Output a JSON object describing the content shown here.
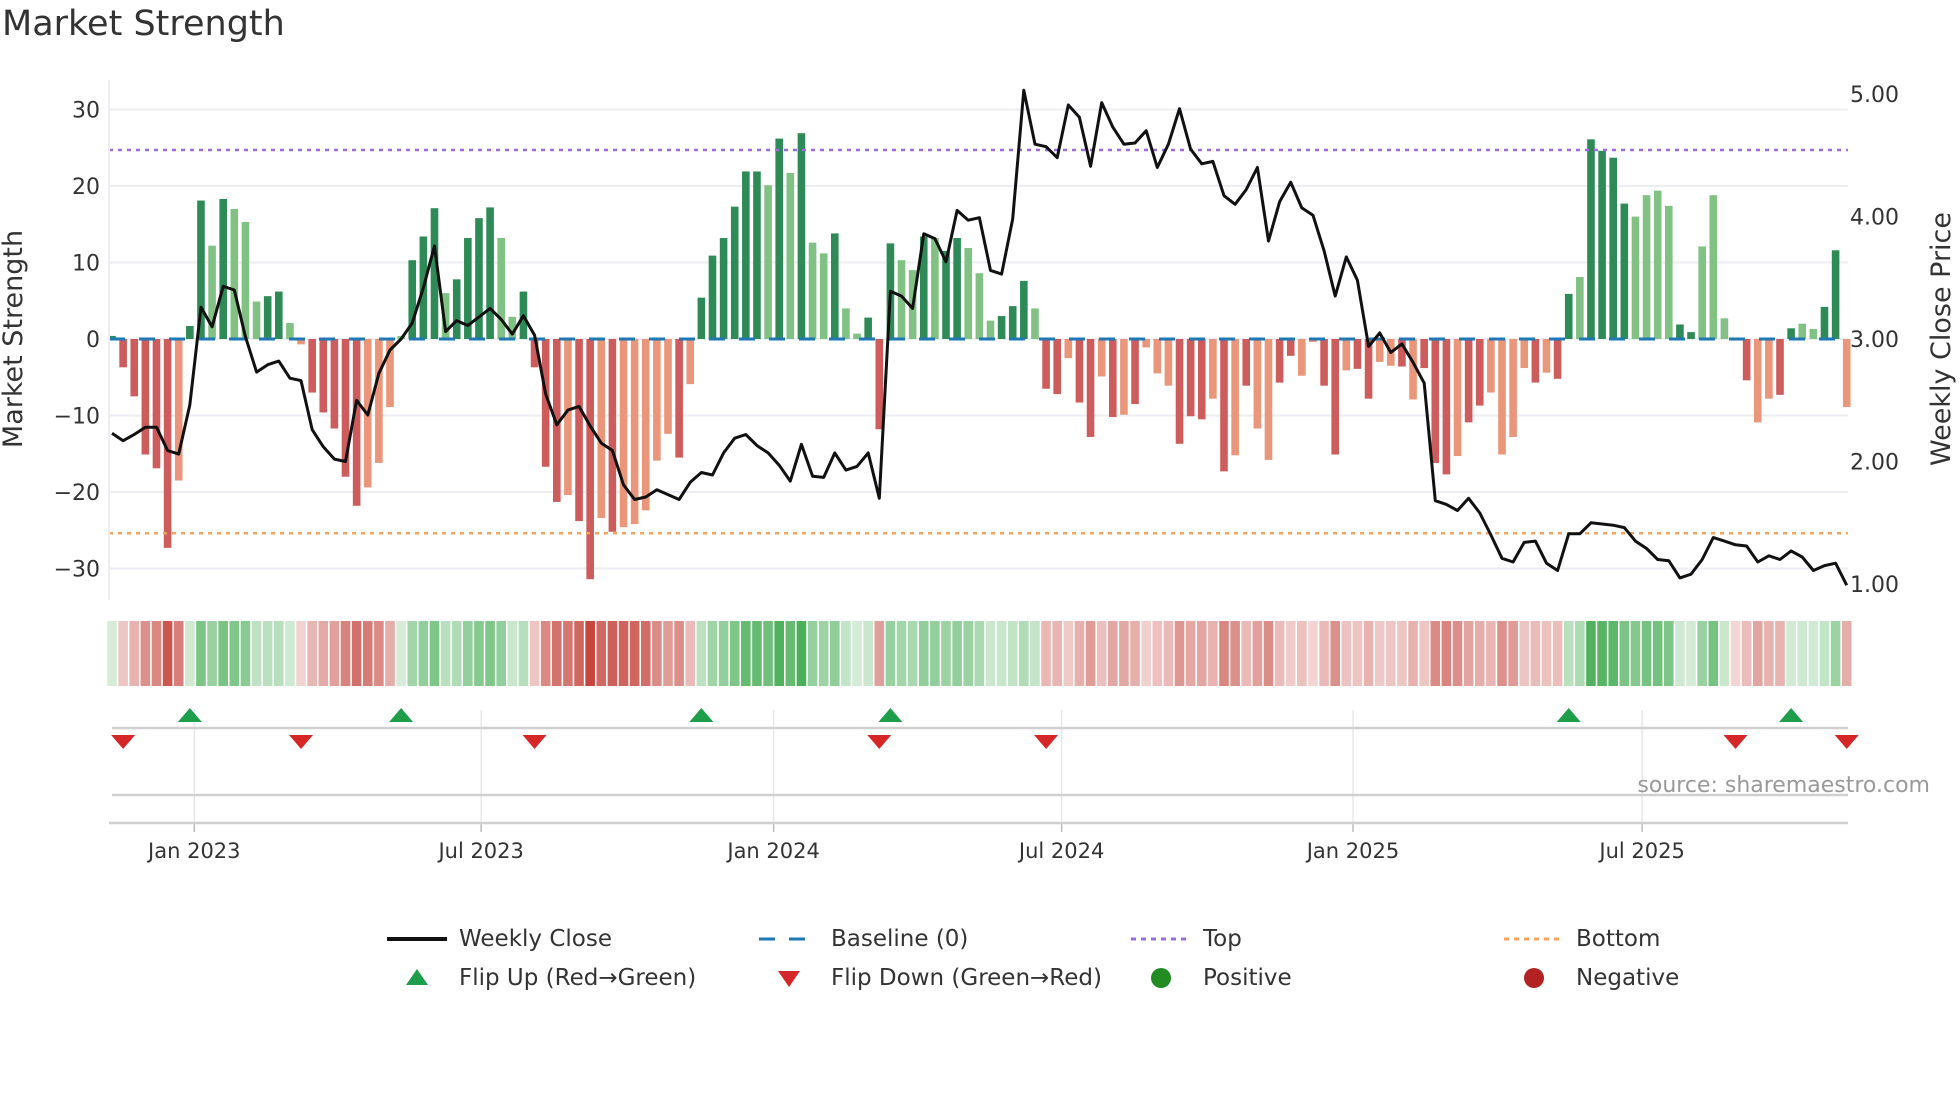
{
  "title": "Market Strength",
  "source": "source: sharemaestro.com",
  "legend": {
    "weekly_close": "Weekly Close",
    "baseline": "Baseline (0)",
    "top": "Top",
    "bottom": "Bottom",
    "flip_up": "Flip Up (Red→Green)",
    "flip_down": "Flip Down (Green→Red)",
    "positive": "Positive",
    "negative": "Negative"
  },
  "colors": {
    "strong_green": "#2e8b57",
    "light_green": "#82c184",
    "strong_red": "#cd5c5c",
    "light_red": "#e9967a",
    "close": "#111111",
    "baseline": "#1f77b4",
    "top": "#9b6ddb",
    "bottom": "#f4a460",
    "flip_up": "#1e9e4a",
    "flip_down": "#d62728",
    "positive": "#228b22",
    "negative": "#b22222"
  },
  "chart_data": {
    "type": "bar",
    "title": "Market Strength",
    "ylabel": "Market Strength",
    "y2label": "Weekly Close Price",
    "ylim": [
      -34,
      33
    ],
    "y2lim": [
      0.93,
      5.13
    ],
    "yticks": [
      "30",
      "20",
      "10",
      "0",
      "−10",
      "−20",
      "−30"
    ],
    "ytick_values": [
      30,
      20,
      10,
      0,
      -10,
      -20,
      -30
    ],
    "y2ticks": [
      "5.00",
      "4.00",
      "3.00",
      "2.00",
      "1.00"
    ],
    "y2tick_values": [
      5,
      4,
      3,
      2,
      1
    ],
    "xticks": [
      {
        "label": "Jan 2023",
        "week": 7.4
      },
      {
        "label": "Jul 2023",
        "week": 33.2
      },
      {
        "label": "Jan 2024",
        "week": 59.5
      },
      {
        "label": "Jul 2024",
        "week": 85.4
      },
      {
        "label": "Jan 2025",
        "week": 111.6
      },
      {
        "label": "Jul 2025",
        "week": 137.6
      }
    ],
    "top_level": 24.7,
    "bottom_level": -25.4,
    "strength": [
      0.4,
      -3.7,
      -7.5,
      -15.1,
      -16.9,
      -27.3,
      -18.5,
      1.7,
      18.1,
      12.2,
      18.3,
      17.0,
      15.3,
      4.9,
      5.6,
      6.2,
      2.1,
      -0.7,
      -7.0,
      -9.6,
      -11.7,
      -18.0,
      -21.8,
      -19.4,
      -16.2,
      -8.9,
      0.4,
      10.3,
      13.4,
      17.1,
      6.0,
      7.8,
      13.2,
      15.8,
      17.2,
      13.2,
      2.9,
      6.2,
      -3.7,
      -16.7,
      -21.3,
      -20.4,
      -23.8,
      -31.4,
      -23.4,
      -25.2,
      -24.6,
      -24.2,
      -22.4,
      -15.9,
      -12.4,
      -15.5,
      -5.9,
      5.4,
      10.9,
      13.2,
      17.3,
      21.9,
      21.9,
      20.1,
      26.2,
      21.7,
      26.9,
      12.6,
      11.2,
      13.8,
      4.0,
      0.7,
      2.8,
      -11.8,
      12.5,
      10.3,
      9.0,
      13.4,
      13.2,
      11.5,
      13.2,
      11.9,
      8.6,
      2.4,
      3.0,
      4.3,
      7.6,
      4.0,
      -6.5,
      -7.2,
      -2.5,
      -8.3,
      -12.8,
      -4.9,
      -10.2,
      -9.9,
      -8.5,
      -1.1,
      -4.5,
      -6.1,
      -13.7,
      -10.1,
      -10.5,
      -7.8,
      -17.3,
      -15.2,
      -6.1,
      -11.7,
      -15.8,
      -5.7,
      -2.2,
      -4.8,
      -0.4,
      -6.1,
      -15.1,
      -4.1,
      -3.9,
      -7.8,
      -3.0,
      -3.5,
      -3.6,
      -7.9,
      -3.8,
      -16.2,
      -17.7,
      -15.3,
      -10.9,
      -8.7,
      -7.0,
      -15.1,
      -12.8,
      -3.8,
      -5.7,
      -4.4,
      -5.2,
      5.9,
      8.1,
      26.1,
      24.6,
      23.7,
      17.7,
      16.0,
      18.8,
      19.4,
      17.4,
      1.9,
      0.9,
      12.1,
      18.8,
      2.7,
      -0.2,
      -5.4,
      -10.9,
      -7.8,
      -7.3,
      1.4,
      2.0,
      1.3,
      4.2,
      11.6,
      -8.9
    ],
    "shade": "ddddddlddldlllddlldddddllllddd lddddllddddlddldllllldlddddddldldlldlldddlldlddllldddlddlddldldllldddldldllddllddlddlldlddd lddlllldlddlddddlllldd llldd llddllddlddd",
    "weekly_close": [
      2.23,
      2.17,
      2.22,
      2.28,
      2.28,
      2.09,
      2.06,
      2.46,
      3.26,
      3.1,
      3.43,
      3.4,
      3.02,
      2.73,
      2.79,
      2.82,
      2.68,
      2.66,
      2.26,
      2.12,
      2.02,
      2.0,
      2.5,
      2.38,
      2.72,
      2.91,
      3.0,
      3.13,
      3.42,
      3.76,
      3.06,
      3.15,
      3.11,
      3.18,
      3.25,
      3.16,
      3.04,
      3.19,
      3.03,
      2.55,
      2.3,
      2.42,
      2.45,
      2.29,
      2.15,
      2.09,
      1.81,
      1.69,
      1.71,
      1.77,
      1.73,
      1.69,
      1.83,
      1.91,
      1.89,
      2.07,
      2.19,
      2.22,
      2.13,
      2.07,
      1.97,
      1.84,
      2.14,
      1.88,
      1.87,
      2.07,
      1.93,
      1.96,
      2.07,
      1.7,
      3.39,
      3.35,
      3.25,
      3.86,
      3.82,
      3.63,
      4.05,
      3.97,
      3.99,
      3.56,
      3.53,
      3.98,
      5.03,
      4.59,
      4.57,
      4.48,
      4.91,
      4.81,
      4.41,
      4.93,
      4.73,
      4.59,
      4.6,
      4.7,
      4.4,
      4.59,
      4.88,
      4.55,
      4.43,
      4.45,
      4.17,
      4.1,
      4.22,
      4.4,
      3.8,
      4.12,
      4.28,
      4.07,
      4.01,
      3.72,
      3.35,
      3.67,
      3.48,
      2.94,
      3.05,
      2.89,
      2.96,
      2.81,
      2.64,
      1.68,
      1.65,
      1.6,
      1.7,
      1.58,
      1.4,
      1.21,
      1.18,
      1.34,
      1.35,
      1.17,
      1.11,
      1.41,
      1.41,
      1.5,
      1.49,
      1.48,
      1.46,
      1.35,
      1.29,
      1.2,
      1.19,
      1.05,
      1.08,
      1.2,
      1.38,
      1.35,
      1.32,
      1.31,
      1.18,
      1.23,
      1.2,
      1.27,
      1.22,
      1.11,
      1.15,
      1.17,
      0.99
    ],
    "flip_up_weeks": [
      7,
      26,
      53,
      70,
      131,
      151
    ],
    "flip_down_weeks": [
      1,
      17,
      38,
      69,
      84,
      146,
      156
    ]
  }
}
